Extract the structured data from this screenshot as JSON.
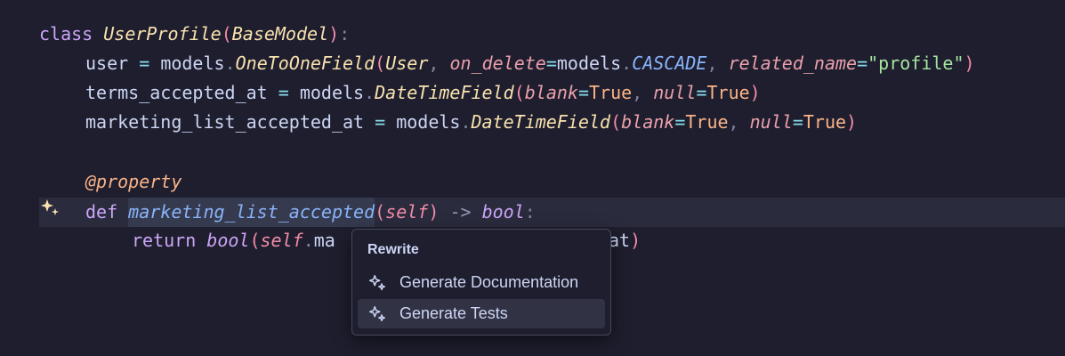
{
  "code": {
    "line1": {
      "kw": "class",
      "name": "UserProfile",
      "open": "(",
      "base": "BaseModel",
      "close": ")",
      "colon": ":"
    },
    "line2": {
      "var": "user",
      "eq": "=",
      "mod": "models",
      "dot": ".",
      "field": "OneToOneField",
      "open": "(",
      "arg1": "User",
      "comma1": ",",
      "kw1": "on_delete",
      "eq1": "=",
      "mod2": "models",
      "dot2": ".",
      "const1": "CASCADE",
      "comma2": ",",
      "kw2": "related_name",
      "eq2": "=",
      "str": "\"profile\"",
      "close": ")"
    },
    "line3": {
      "var": "terms_accepted_at",
      "eq": "=",
      "mod": "models",
      "dot": ".",
      "field": "DateTimeField",
      "open": "(",
      "kw1": "blank",
      "eq1": "=",
      "val1": "True",
      "comma": ",",
      "kw2": "null",
      "eq2": "=",
      "val2": "True",
      "close": ")"
    },
    "line4": {
      "var": "marketing_list_accepted_at",
      "eq": "=",
      "mod": "models",
      "dot": ".",
      "field": "DateTimeField",
      "open": "(",
      "kw1": "blank",
      "eq1": "=",
      "val1": "True",
      "comma": ",",
      "kw2": "null",
      "eq2": "=",
      "val2": "True",
      "close": ")"
    },
    "line6": {
      "decorator": "@property"
    },
    "line7": {
      "kw": "def",
      "fn": "marketing_list_accepted",
      "open": "(",
      "self": "self",
      "close": ")",
      "arrow": "->",
      "type": "bool",
      "colon": ":"
    },
    "line8": {
      "kw": "return",
      "fn": "bool",
      "open": "(",
      "self": "self",
      "dot": ".",
      "partial": "ma",
      "tail": "at",
      "close": ")"
    }
  },
  "gutter": {
    "icon": "sparkle-icon"
  },
  "menu": {
    "heading": "Rewrite",
    "items": [
      {
        "label": "Generate Documentation",
        "icon": "sparkle-icon",
        "highlighted": false
      },
      {
        "label": "Generate Tests",
        "icon": "sparkle-icon",
        "highlighted": true
      }
    ]
  },
  "colors": {
    "background": "#1e1e2e",
    "current_line": "#2a2b3d",
    "menu_highlight": "#313244",
    "gutter_icon": "#f9e2af"
  }
}
